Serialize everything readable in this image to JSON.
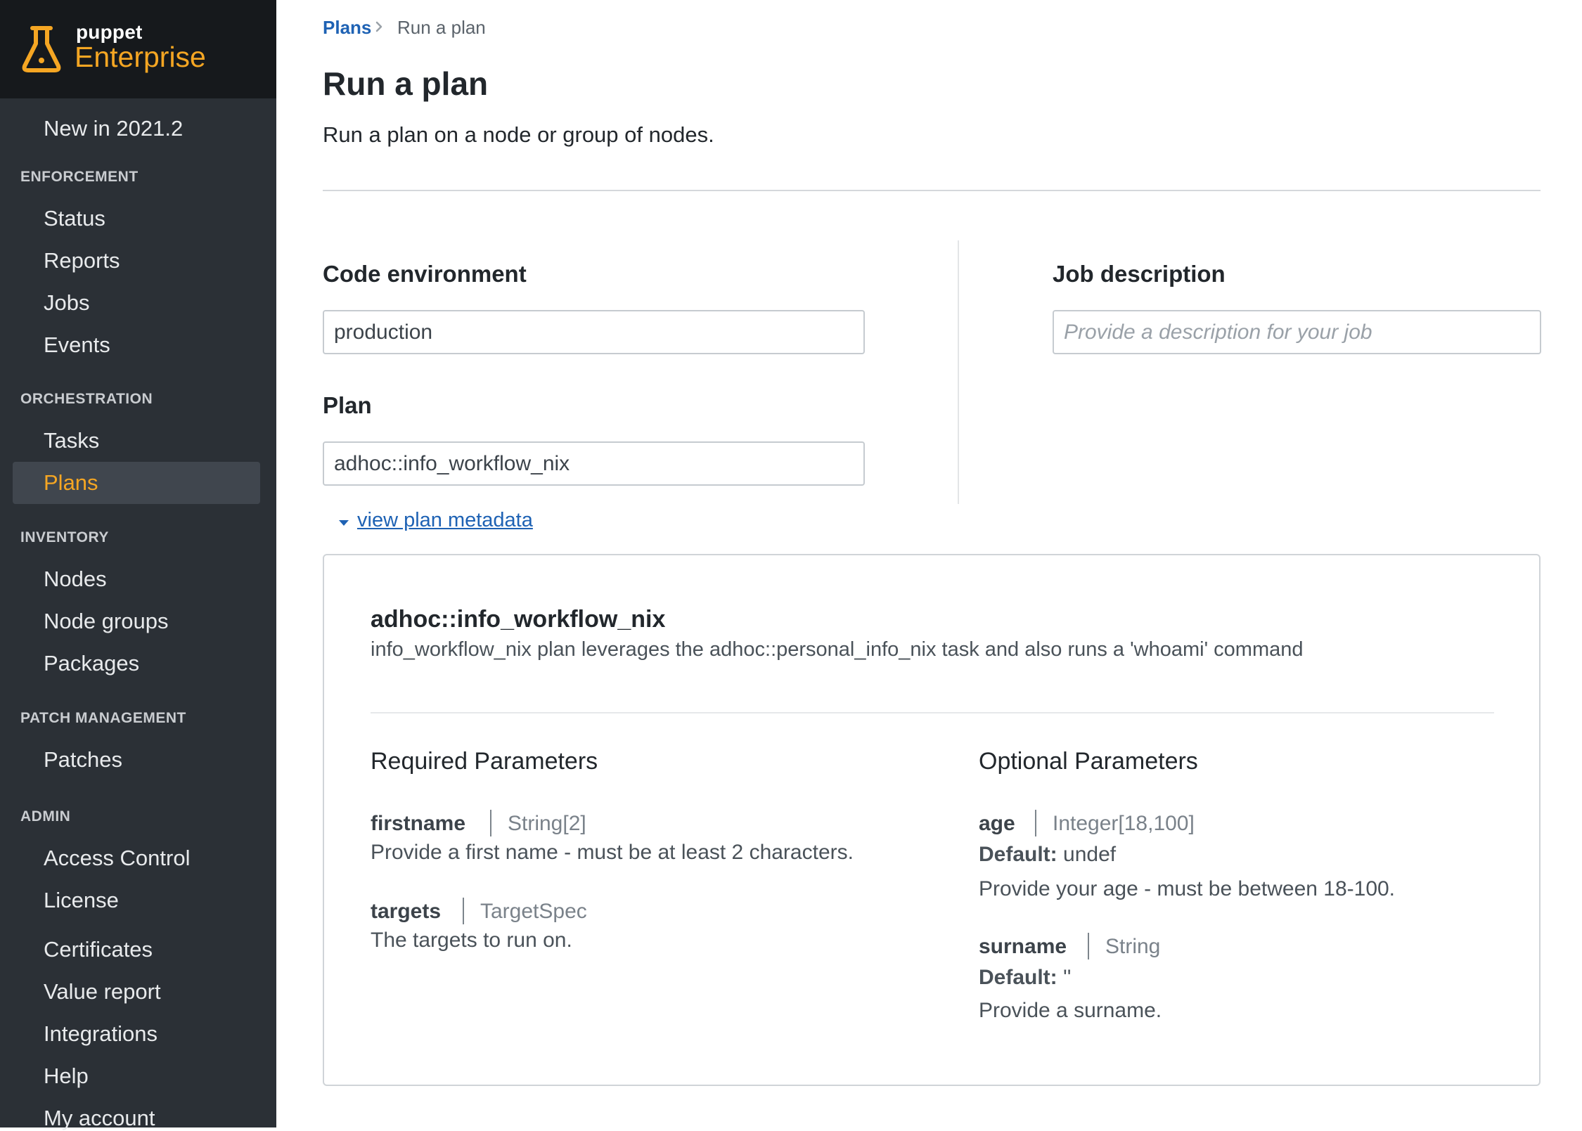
{
  "brand": {
    "small": "puppet",
    "big": "Enterprise",
    "icon": "flask-icon",
    "accent": "#f5a623"
  },
  "sidebar": {
    "top_item": "New in 2021.2",
    "sections": [
      {
        "title": "ENFORCEMENT",
        "items": [
          "Status",
          "Reports",
          "Jobs",
          "Events"
        ]
      },
      {
        "title": "ORCHESTRATION",
        "items": [
          "Tasks",
          "Plans"
        ]
      },
      {
        "title": "INVENTORY",
        "items": [
          "Nodes",
          "Node groups",
          "Packages"
        ]
      },
      {
        "title": "PATCH MANAGEMENT",
        "items": [
          "Patches"
        ]
      },
      {
        "title": "ADMIN",
        "items": [
          "Access Control",
          "License",
          "Certificates",
          "Value report",
          "Integrations",
          "Help",
          "My account"
        ]
      }
    ],
    "active_item": "Plans"
  },
  "breadcrumb": {
    "link": "Plans",
    "current": "Run a plan"
  },
  "page": {
    "title": "Run a plan",
    "subtitle": "Run a plan on a node or group of nodes."
  },
  "form": {
    "code_env_label": "Code environment",
    "code_env_value": "production",
    "plan_label": "Plan",
    "plan_value": "adhoc::info_workflow_nix",
    "job_desc_label": "Job description",
    "job_desc_placeholder": "Provide a description for your job",
    "metadata_toggle": "view plan metadata"
  },
  "metadata": {
    "plan_name": "adhoc::info_workflow_nix",
    "plan_description": "info_workflow_nix plan leverages the adhoc::personal_info_nix task and also runs a 'whoami' command",
    "required_title": "Required Parameters",
    "optional_title": "Optional Parameters",
    "default_label": "Default:",
    "required": [
      {
        "name": "firstname",
        "type": "String[2]",
        "description": "Provide a first name - must be at least 2 characters."
      },
      {
        "name": "targets",
        "type": "TargetSpec",
        "description": "The targets to run on."
      }
    ],
    "optional": [
      {
        "name": "age",
        "type": "Integer[18,100]",
        "default": "undef",
        "description": "Provide your age - must be between 18-100."
      },
      {
        "name": "surname",
        "type": "String",
        "default": "''",
        "description": "Provide a surname."
      }
    ]
  }
}
